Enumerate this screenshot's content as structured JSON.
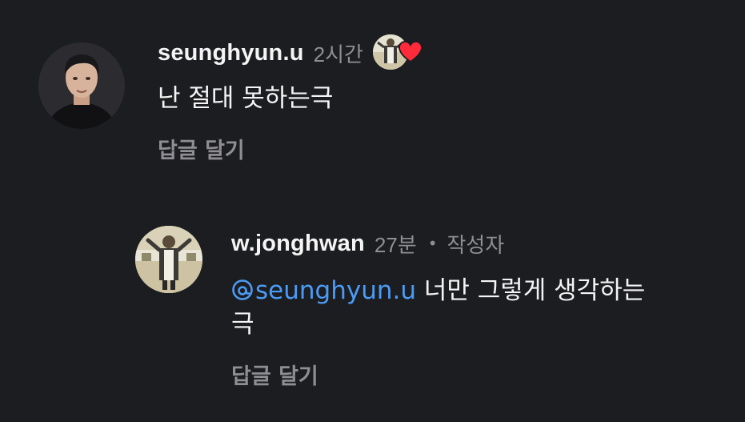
{
  "comments": [
    {
      "username": "seunghyun.u",
      "time": "2시간",
      "text": "난 절대 못하는극",
      "reply_label": "답글 달기",
      "liked_by_author": true
    },
    {
      "username": "w.jonghwan",
      "time": "27분",
      "separator": "•",
      "author_tag": "작성자",
      "mention": "seunghyun.u",
      "text_after_mention": " 너만 그렇게 생각하는 극",
      "reply_label": "답글 달기"
    }
  ],
  "colors": {
    "background": "#1c1d21",
    "text": "#f4f4f4",
    "muted": "#8e8e93",
    "mention": "#4a9bf5",
    "heart": "#ff2a3a"
  },
  "icons": {
    "heart": "heart-icon",
    "mention": "threads-at-icon"
  }
}
